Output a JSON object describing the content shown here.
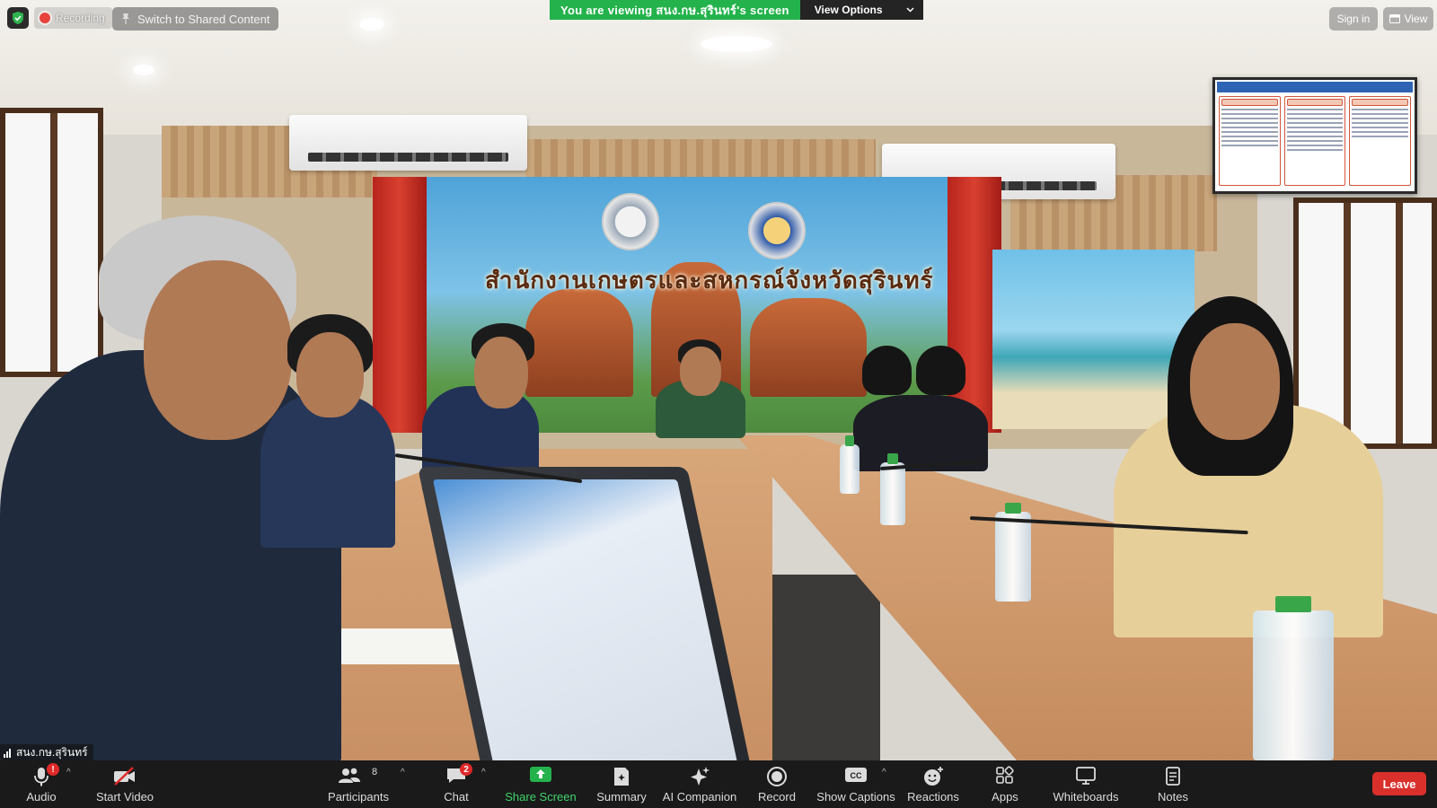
{
  "top_bar": {
    "recording_label": "Recording",
    "switch_label": "Switch to Shared Content",
    "viewing_text": "You are viewing สนง.กษ.สุรินทร์'s screen",
    "view_options_label": "View Options",
    "sign_in_label": "Sign in",
    "view_label": "View"
  },
  "scene": {
    "banner_title": "สำนักงานเกษตรและสหกรณ์จังหวัดสุรินทร์"
  },
  "participant": {
    "name": "สนง.กษ.สุรินทร์"
  },
  "toolbar": {
    "audio_label": "Audio",
    "audio_badge": "!",
    "video_label": "Start Video",
    "participants_label": "Participants",
    "participants_count": "8",
    "chat_label": "Chat",
    "chat_badge": "2",
    "share_label": "Share Screen",
    "summary_label": "Summary",
    "ai_label": "AI Companion",
    "record_label": "Record",
    "captions_label": "Show Captions",
    "reactions_label": "Reactions",
    "apps_label": "Apps",
    "whiteboards_label": "Whiteboards",
    "notes_label": "Notes",
    "leave_label": "Leave"
  },
  "colors": {
    "share_green": "#23b24b",
    "leave_red": "#d9302c",
    "toolbar_bg": "#1a1a1a"
  }
}
